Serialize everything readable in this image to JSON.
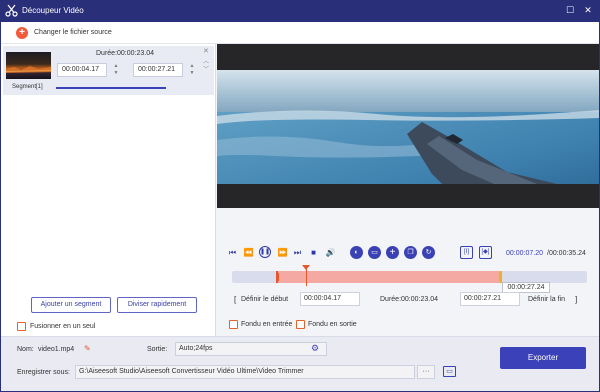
{
  "window": {
    "title": "Découpeur Vidéo"
  },
  "topbar": {
    "change_source_label": "Changer le fichier source"
  },
  "segment": {
    "duration": "Durée:00:00:23.04",
    "start": "00:00:04.17",
    "end": "00:00:27.21",
    "label": "Segment[1]"
  },
  "left_actions": {
    "add_segment": "Ajouter un segment",
    "quick_split": "Diviser rapidement",
    "merge": "Fusionner en un seul"
  },
  "player": {
    "current_time": "00:00:07.20",
    "total_time": "/00:00:35.24",
    "hover_time": "00:00:27.24",
    "set_start": "Définir le début",
    "start_value": "00:00:04.17",
    "duration": "Durée:00:00:23.04",
    "end_value": "00:00:27.21",
    "set_end": "Définir la fin",
    "fade_in": "Fondu en entrée",
    "fade_out": "Fondu en sortie"
  },
  "bottom": {
    "name_label": "Nom:",
    "name_value": "video1.mp4",
    "output_label": "Sortie:",
    "output_value": "Auto;24fps",
    "save_label": "Enregistrer sous:",
    "save_path": "G:\\Aiseesoft Studio\\Aiseesoft Convertisseur Vidéo Ultime\\Video Trimmer",
    "browse": "···",
    "export": "Exporter"
  },
  "colors": {
    "accent": "#3b41b8",
    "title_bg": "#2a2f7a",
    "orange": "#f15a3a"
  }
}
